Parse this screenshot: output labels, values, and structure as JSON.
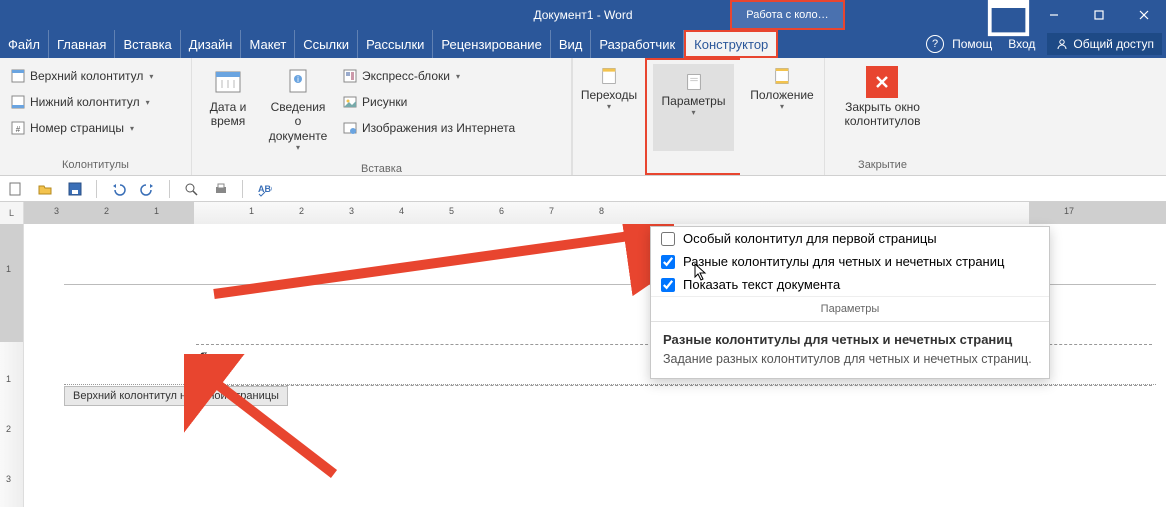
{
  "title": "Документ1 - Word",
  "context_tab": "Работа с коло…",
  "menubar": {
    "file": "Файл",
    "home": "Главная",
    "insert": "Вставка",
    "design": "Дизайн",
    "layout": "Макет",
    "references": "Ссылки",
    "mailings": "Рассылки",
    "review": "Рецензирование",
    "view": "Вид",
    "developer": "Разработчик",
    "designer_active": "Конструктор",
    "help": "Помощ",
    "signin": "Вход",
    "share": "Общий доступ"
  },
  "ribbon": {
    "headersfooters": {
      "header": "Верхний колонтитул",
      "footer": "Нижний колонтитул",
      "pagenum": "Номер страницы",
      "group": "Колонтитулы"
    },
    "insert": {
      "datetime": "Дата и время",
      "docinfo": "Сведения о документе",
      "quickparts": "Экспресс-блоки",
      "pictures": "Рисунки",
      "onlinepics": "Изображения из Интернета",
      "group": "Вставка"
    },
    "navigation": {
      "gotoheader": "Переходы",
      "group": ""
    },
    "options": {
      "label": "Параметры",
      "group": ""
    },
    "position": {
      "label": "Положение",
      "group": ""
    },
    "close": {
      "label1": "Закрыть окно",
      "label2": "колонтитулов",
      "group": "Закрытие"
    }
  },
  "options_panel": {
    "opt1": {
      "label": "Особый колонтитул для первой страницы",
      "checked": false
    },
    "opt2": {
      "label": "Разные колонтитулы для четных и нечетных страниц",
      "checked": true
    },
    "opt3": {
      "label": "Показать текст документа",
      "checked": true
    },
    "group": "Параметры",
    "tooltip_title": "Разные колонтитулы для четных и нечетных страниц",
    "tooltip_body": "Задание разных колонтитулов для четных и нечетных страниц."
  },
  "document": {
    "header_tag": "Верхний колонтитул нечетной страницы",
    "pilcrow": "¶"
  },
  "ruler_corner": "L"
}
